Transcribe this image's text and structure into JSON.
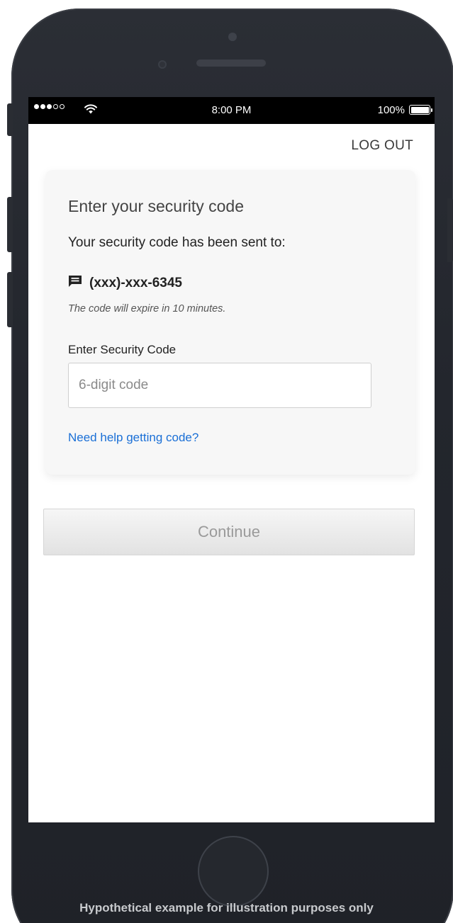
{
  "statusbar": {
    "time": "8:00 PM",
    "battery_percent": "100%",
    "signal_bars_filled": 3,
    "signal_bars_total": 5,
    "battery_level": 1.0
  },
  "header": {
    "logout_label": "LOG OUT"
  },
  "card": {
    "title": "Enter your security code",
    "sent_to_text": "Your security code has been sent to:",
    "phone_number": "(xxx)-xxx-6345",
    "expire_text": "The code will expire in 10 minutes.",
    "field_label": "Enter Security Code",
    "input_placeholder": "6-digit code",
    "input_value": "",
    "help_link": "Need help getting code?"
  },
  "actions": {
    "continue_label": "Continue"
  },
  "footer": {
    "disclaimer": "Hypothetical example for illustration purposes only"
  },
  "colors": {
    "link": "#1a6fd6",
    "button_text_disabled": "#9a9a9a",
    "card_background": "#f7f7f7",
    "phone_frame": "#23262d"
  },
  "icons": {
    "message": "message-icon",
    "wifi": "wifi-icon",
    "battery": "battery-icon"
  }
}
